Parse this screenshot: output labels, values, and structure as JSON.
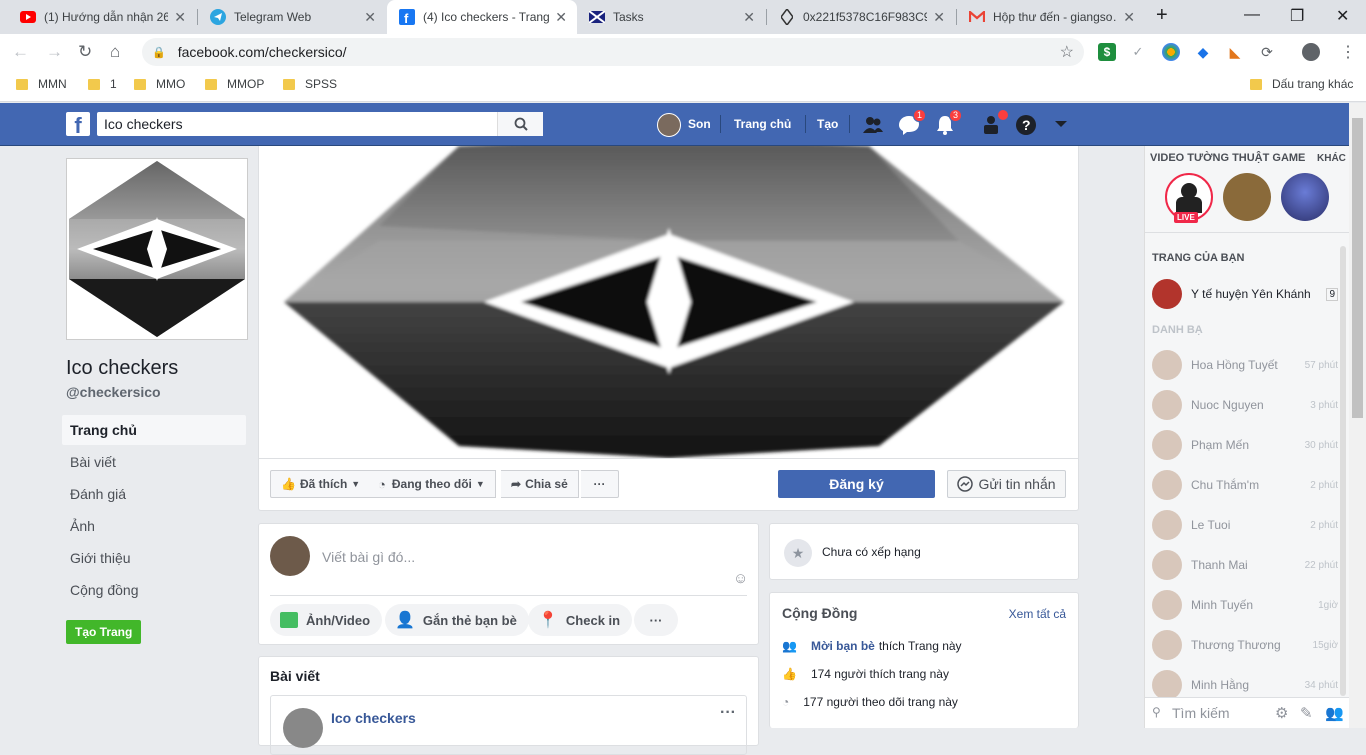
{
  "browser": {
    "tabs": [
      {
        "title": "(1) Hướng dẫn nhận 26…",
        "icon": "youtube-icon"
      },
      {
        "title": "Telegram Web",
        "icon": "telegram-icon"
      },
      {
        "title": "(4) Ico checkers - Trang…",
        "icon": "facebook-icon"
      },
      {
        "title": "Tasks",
        "icon": "tasks-icon"
      },
      {
        "title": "0x221f5378C16F983C9…",
        "icon": "ethereum-icon"
      },
      {
        "title": "Hộp thư đến - giangso…",
        "icon": "gmail-icon"
      }
    ],
    "new_tab": "+",
    "url": "facebook.com/checkersico/",
    "bookmarks": [
      "MMN",
      "1",
      "MMO",
      "MMOP",
      "SPSS"
    ],
    "other_bookmarks": "Dấu trang khác"
  },
  "fb": {
    "search_value": "Ico checkers",
    "user_name": "Son",
    "home": "Trang chủ",
    "create": "Tạo",
    "messenger_badge": "1",
    "notif_badge": "3"
  },
  "page": {
    "name": "Ico checkers",
    "handle": "@checkersico",
    "nav": [
      "Trang chủ",
      "Bài viết",
      "Đánh giá",
      "Ảnh",
      "Giới thiệu",
      "Cộng đồng"
    ],
    "create_page": "Tạo Trang",
    "liked": "Đã thích",
    "following": "Đang theo dõi",
    "share": "Chia sẻ",
    "more": "···",
    "subscribe": "Đăng ký",
    "send_message": "Gửi tin nhắn"
  },
  "composer": {
    "placeholder": "Viết bài gì đó...",
    "photo_video": "Ảnh/Video",
    "tag_friends": "Gắn thẻ bạn bè",
    "check_in": "Check in"
  },
  "posts": {
    "title": "Bài viết",
    "first_author": "Ico checkers"
  },
  "rating": {
    "text": "Chưa có xếp hạng"
  },
  "community": {
    "title": "Cộng Đồng",
    "see_all": "Xem tất cả",
    "invite_link": "Mời bạn bè",
    "invite_rest": "thích Trang này",
    "likes": "174 người thích trang này",
    "follows": "177 người theo dõi trang này"
  },
  "sidebar": {
    "video_title": "VIDEO TƯỜNG THUẬT GAME",
    "other": "KHÁC",
    "live": "LIVE",
    "your_pages": "TRANG CỦA BẠN",
    "your_page_name": "Y tế huyện Yên Khánh",
    "your_page_count": "9",
    "contacts_title": "DANH BẠ",
    "contacts": [
      {
        "name": "Hoa Hồng Tuyết",
        "time": "57 phút"
      },
      {
        "name": "Nuoc Nguyen",
        "time": "3 phút"
      },
      {
        "name": "Phạm Mến",
        "time": "30 phút"
      },
      {
        "name": "Chu Thắm'm",
        "time": "2 phút"
      },
      {
        "name": "Le Tuoi",
        "time": "2 phút"
      },
      {
        "name": "Thanh Mai",
        "time": "22 phút"
      },
      {
        "name": "Minh Tuyến",
        "time": "1giờ"
      },
      {
        "name": "Thương Thương",
        "time": "15giờ"
      },
      {
        "name": "Minh Hằng",
        "time": "34 phút"
      }
    ],
    "search_placeholder": "Tìm kiếm"
  }
}
